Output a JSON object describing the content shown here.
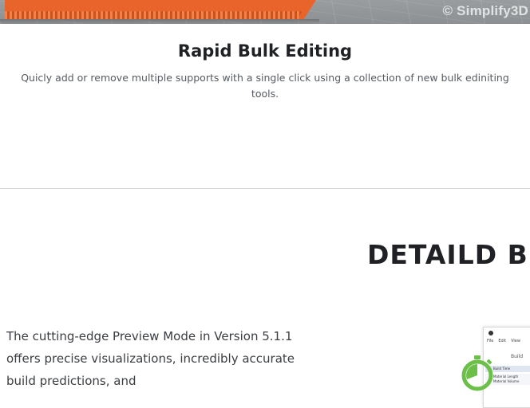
{
  "hero": {
    "watermark": "© Simplify3D"
  },
  "feature": {
    "title": "Rapid Bulk Editing",
    "description": "Quicly add or remove multiple supports with a single click using a collection of new bulk ediniting tools."
  },
  "section": {
    "heading": "DETAILD B",
    "body": "The cutting-edge Preview Mode in Version 5.1.1 offers precise visualizations, incredibly accurate build predictions, and"
  },
  "app_preview": {
    "menu": [
      "File",
      "Edit",
      "View"
    ],
    "panel_title": "Build",
    "rows": [
      "Build Time",
      "Material Length",
      "Material Volume"
    ]
  },
  "colors": {
    "model_orange": "#e8642a",
    "stopwatch_green": "#6cc04a"
  },
  "icons": {
    "stopwatch": "stopwatch-icon",
    "logo": "app-logo-icon"
  }
}
